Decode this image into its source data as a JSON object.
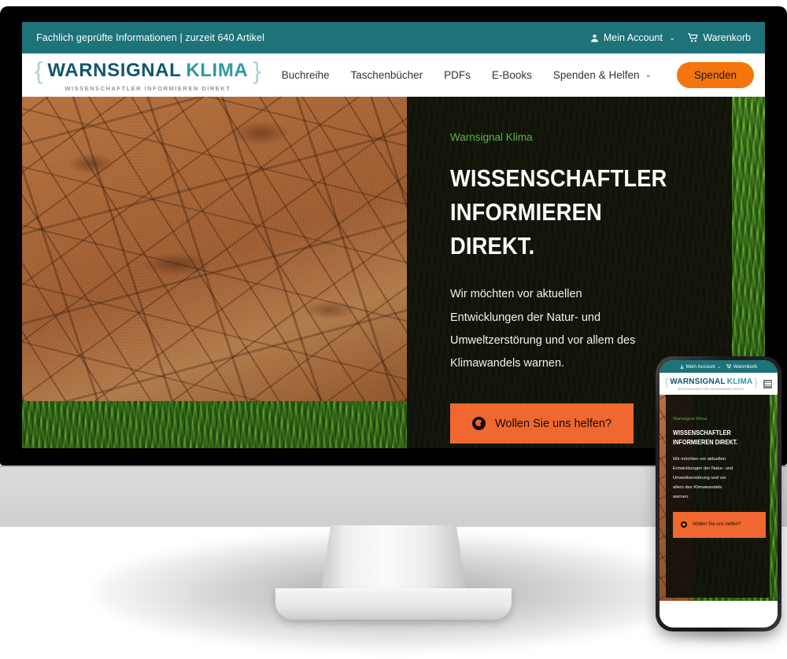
{
  "site": {
    "topbar": {
      "tagline": "Fachlich geprüfte Informationen | zurzeit 640 Artikel",
      "account_label": "Mein Account",
      "account_chevron": "⌄",
      "account_icon": "person-icon",
      "cart_label": "Warenkorb",
      "cart_icon": "cart-icon"
    },
    "logo": {
      "brace_left": "{",
      "brace_right": "}",
      "word_one": "WARNSIGNAL",
      "word_two": "KLIMA",
      "subtitle": "WISSENSCHAFTLER INFORMIEREN DIREKT"
    },
    "nav": {
      "items": [
        {
          "label": "Buchreihe",
          "has_chevron": false
        },
        {
          "label": "Taschenbücher",
          "has_chevron": false
        },
        {
          "label": "PDFs",
          "has_chevron": false
        },
        {
          "label": "E-Books",
          "has_chevron": false
        },
        {
          "label": "Spenden & Helfen",
          "has_chevron": true
        }
      ],
      "spenden_chevron": "⌄",
      "donate_button": "Spenden"
    },
    "hero": {
      "eyebrow": "Warnsignal Klima",
      "heading_line1": "Wissenschaftler",
      "heading_line2": "informieren direkt.",
      "paragraph": "Wir möchten vor aktuellen Entwicklungen der Natur- und Umweltzerstörung und vor allem des Klimawandels warnen.",
      "cta_label": "Wollen Sie uns helfen?",
      "cta_icon": "globe-icon"
    }
  },
  "phone": {
    "topbar": {
      "account_label": "Mein Account",
      "account_chevron": "⌄",
      "cart_label": "Warenkorb"
    },
    "logo": {
      "brace_left": "{",
      "brace_right": "}",
      "word_one": "WARNSIGNAL",
      "word_two": "KLIMA",
      "subtitle": "WISSENSCHAFTLER INFORMIEREN DIREKT"
    },
    "menu_icon": "hamburger-menu-icon",
    "hero": {
      "eyebrow": "Warnsignal Klima",
      "heading": "Wissenschaftler informieren direkt.",
      "paragraph": "Wir möchten vor aktuellen Entwicklungen der Natur- und Umweltzerstörung und vor allem des Klimawandels warnen.",
      "cta_label": "Wollen Sie uns helfen?",
      "cta_icon": "globe-icon"
    }
  },
  "colors": {
    "teal_bar": "#1d7378",
    "logo_dark": "#14566b",
    "logo_light": "#2e9aa0",
    "orange_button": "#f5740d",
    "orange_cta": "#f0672f",
    "eyebrow_green": "#5fae4b",
    "overlay_dark": "#0e0c09"
  }
}
